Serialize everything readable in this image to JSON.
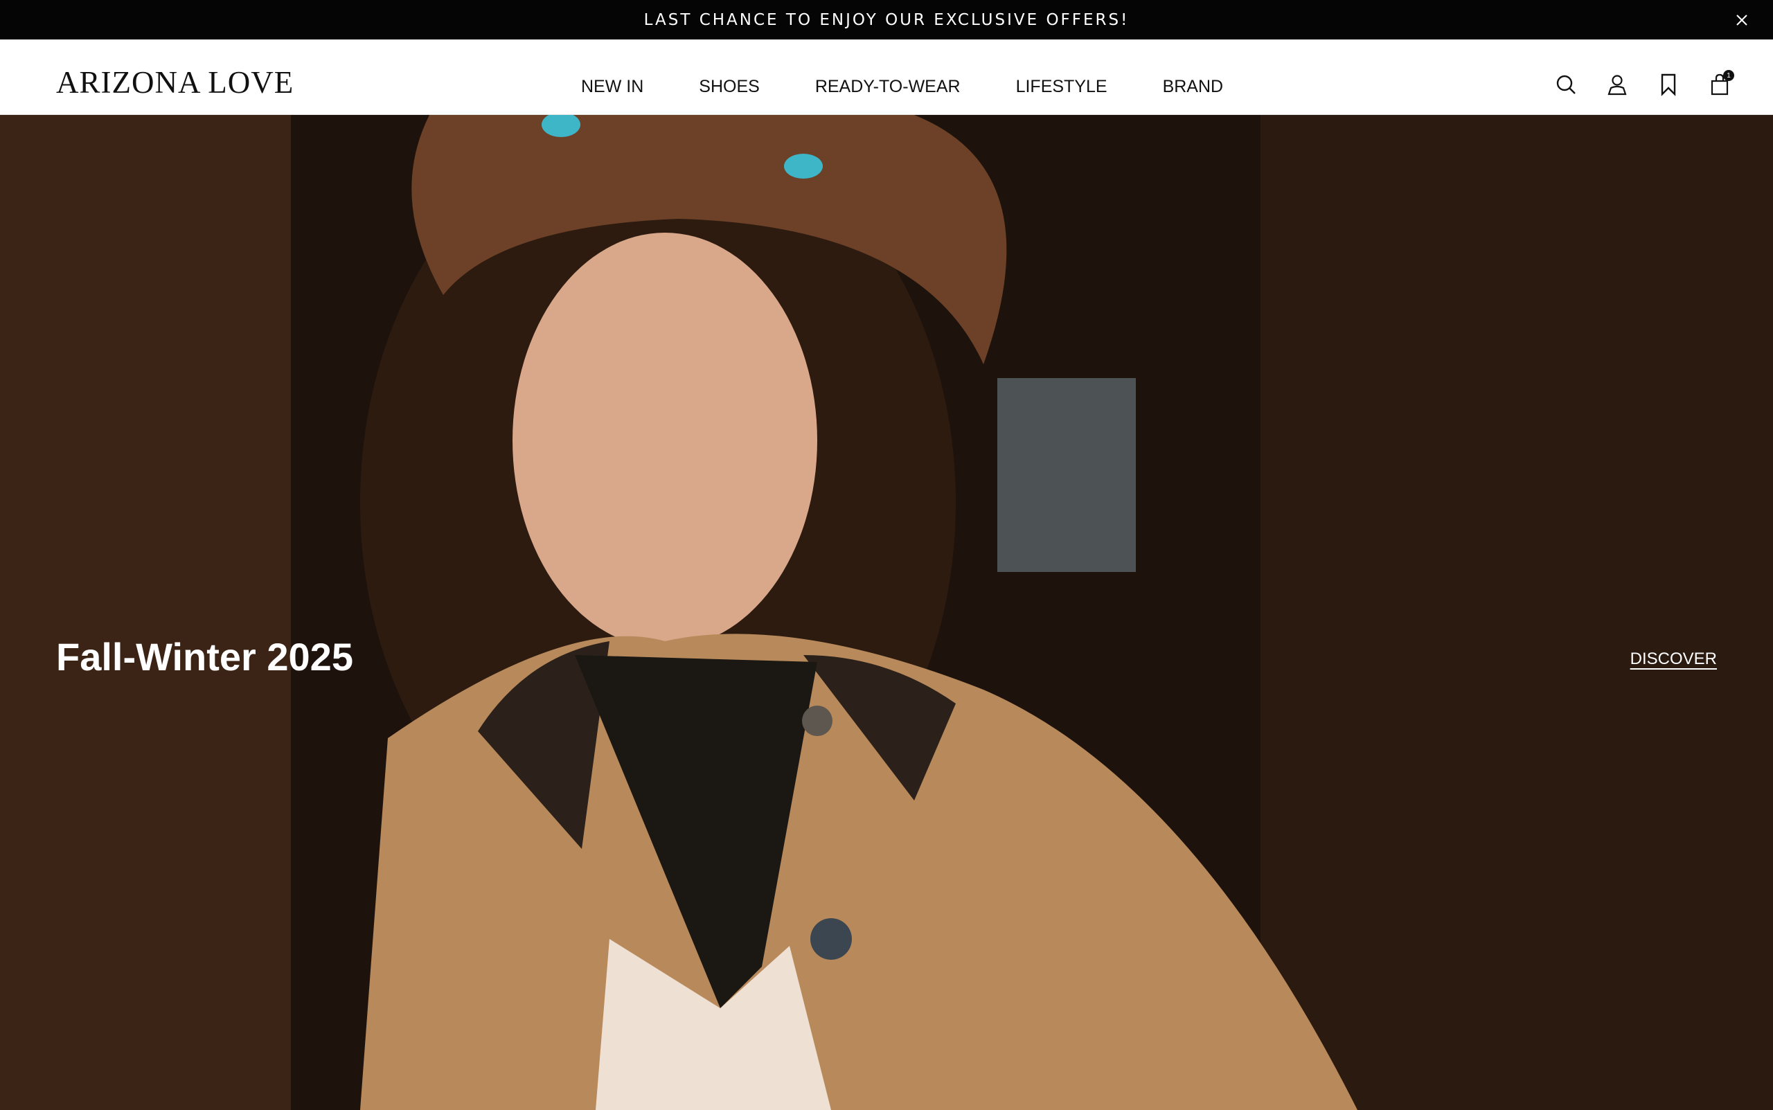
{
  "announcement": {
    "text": "LAST CHANCE TO ENJOY OUR EXCLUSIVE OFFERS!",
    "close_icon": "close-icon"
  },
  "header": {
    "logo": "ARIZONA LOVE",
    "nav": [
      "NEW IN",
      "SHOES",
      "READY-TO-WEAR",
      "LIFESTYLE",
      "BRAND"
    ],
    "icons": [
      "search-icon",
      "account-icon",
      "bookmark-icon",
      "cart-icon"
    ],
    "cart_count": "1"
  },
  "hero": {
    "title": "Fall-Winter 2025",
    "cta": "DISCOVER"
  },
  "colors": {
    "announcement_bg": "#050505",
    "header_bg": "#ffffff",
    "text_dark": "#111111"
  }
}
